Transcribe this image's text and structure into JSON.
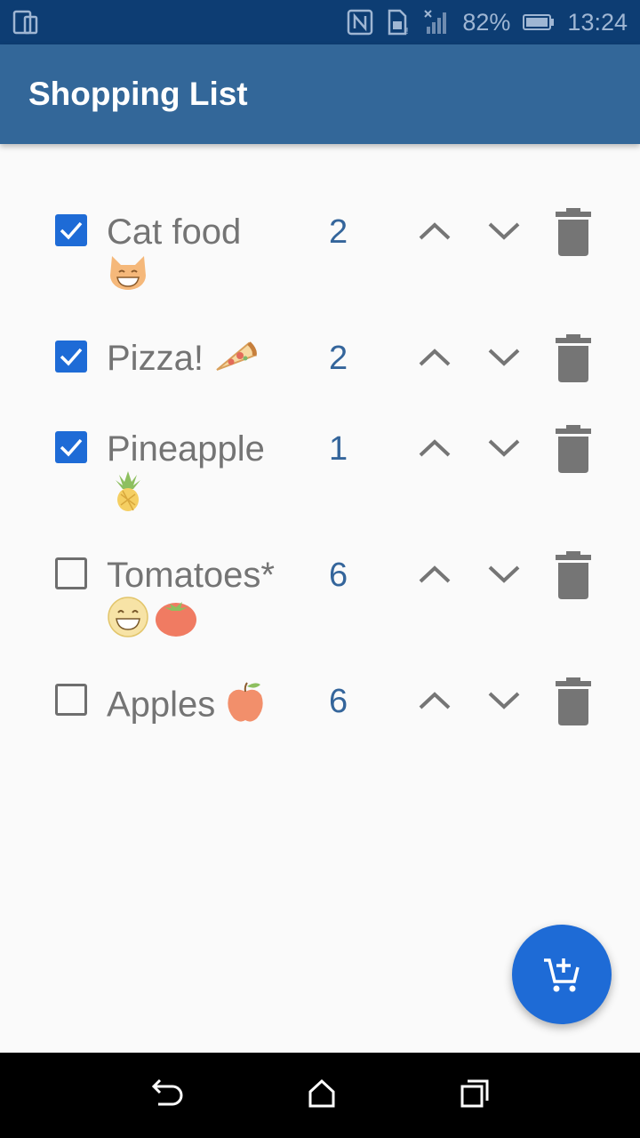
{
  "status_bar": {
    "battery_percent": "82%",
    "time": "13:24"
  },
  "app_bar": {
    "title": "Shopping List"
  },
  "items": [
    {
      "name": "Cat food",
      "emoji": "grinning-cat",
      "quantity": "2",
      "checked": true
    },
    {
      "name": "Pizza!",
      "emoji": "pizza",
      "quantity": "2",
      "checked": true
    },
    {
      "name": "Pineapple",
      "emoji": "pineapple",
      "quantity": "1",
      "checked": true
    },
    {
      "name": "Tomatoes*",
      "emoji": "grin-face+tomato",
      "quantity": "6",
      "checked": false
    },
    {
      "name": "Apples",
      "emoji": "apple",
      "quantity": "6",
      "checked": false
    }
  ],
  "fab": {
    "icon": "add-shopping-cart-icon"
  },
  "colors": {
    "status_bar": "#0d3d73",
    "app_bar": "#336799",
    "accent": "#1e6bd6",
    "quantity": "#34659b",
    "text": "#747474",
    "icon_gray": "#6e6e6e"
  }
}
